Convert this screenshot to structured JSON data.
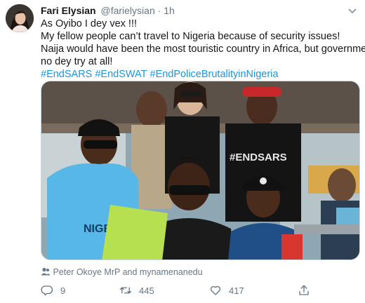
{
  "tweet": {
    "display_name": "Fari Elysian",
    "handle": "@farielysian",
    "separator": "·",
    "time": "1h",
    "lines": [
      "As Oyibo I dey vex !!!",
      "My fellow people can’t travel to Nigeria because of security issues!",
      "Naija would have been the most touristic country in Africa, but government",
      "no dey try at all!"
    ],
    "hashtags": [
      "#EndSARS",
      "#EndSWAT",
      "#EndPoliceBrutalityinNigeria"
    ],
    "media_text": {
      "shirt_left": "NIGER",
      "shirt_center": "#ENDSARS"
    },
    "tagged_people": "Peter Okoye MrP and mynamenanedu",
    "counts": {
      "replies": "9",
      "retweets": "445",
      "likes": "417"
    }
  },
  "colors": {
    "text": "#14171a",
    "muted": "#657786",
    "link": "#1b95e0"
  },
  "icons": [
    "caret-down-icon",
    "person-icon",
    "reply-icon",
    "retweet-icon",
    "like-icon",
    "share-icon"
  ]
}
